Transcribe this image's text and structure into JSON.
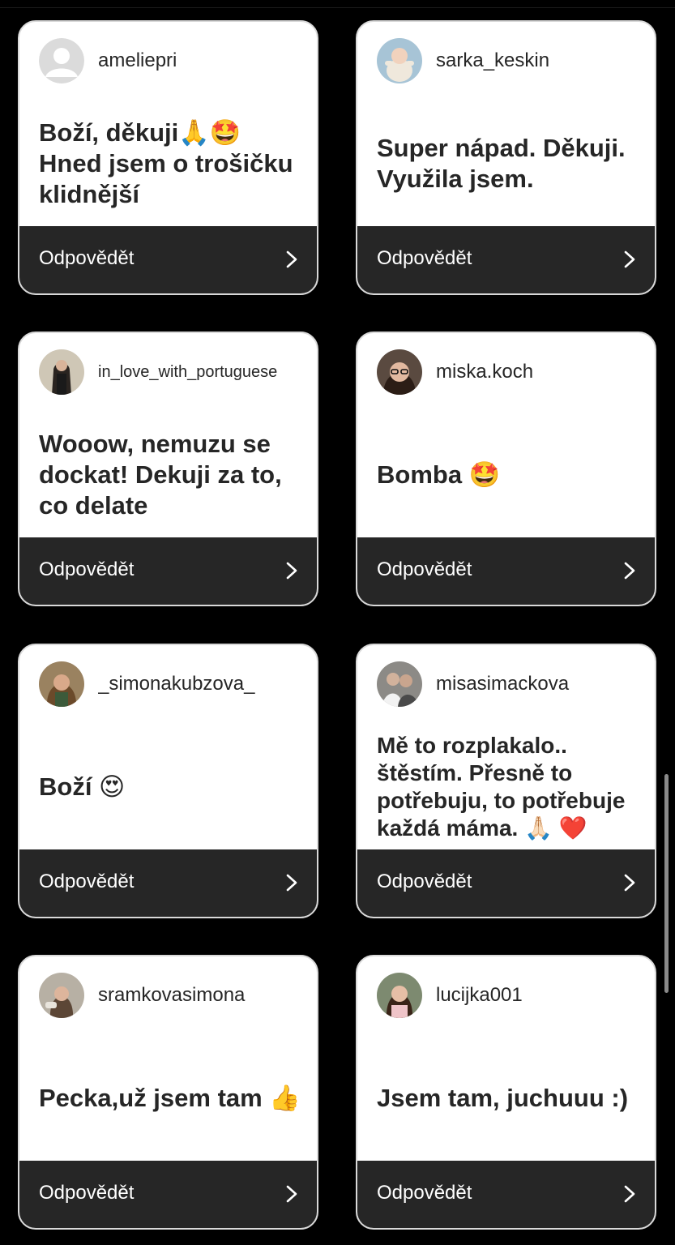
{
  "reply_label": "Odpovědět",
  "cards": [
    {
      "username": "ameliepri",
      "message": "Boží, děkuji🙏🤩 Hned jsem o trošičku klidnější",
      "avatar": "default-avatar-icon"
    },
    {
      "username": "sarka_keskin",
      "message": "Super nápad. Děkuji. Využila jsem.",
      "avatar": "baby-photo"
    },
    {
      "username": "in_love_with_portuguese",
      "message": "Wooow, nemuzu se dockat! Dekuji za to, co delate",
      "avatar": "portrait-photo"
    },
    {
      "username": "miska.koch",
      "message": "Bomba 🤩",
      "avatar": "portrait-photo"
    },
    {
      "username": "_simonakubzova_",
      "message": "Boží 😍",
      "avatar": "portrait-photo"
    },
    {
      "username": "misasimackova",
      "message": "Mě to rozplakalo.. štěstím. Přesně to potřebuju, to potřebuje každá máma. 🙏🏻 ❤️",
      "avatar": "portrait-photo"
    },
    {
      "username": "sramkovasimona",
      "message": "Pecka,už jsem tam 👍",
      "avatar": "portrait-photo"
    },
    {
      "username": "lucijka001",
      "message": "Jsem tam, juchuuu :)",
      "avatar": "portrait-photo"
    }
  ]
}
